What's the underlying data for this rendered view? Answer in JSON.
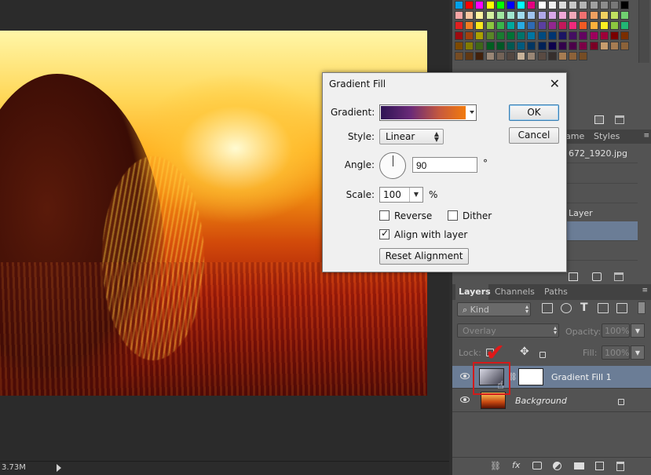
{
  "status": {
    "zoom_text": "3.73M"
  },
  "swatches": {
    "colors": [
      [
        "#00a0e9",
        "#ff0000",
        "#ff00ff",
        "#ffff00",
        "#00ff00",
        "#0000ff",
        "#00ffff",
        "#e4007f",
        "#ffffff",
        "#f0f0f0",
        "#dcdcdc",
        "#c8c8c8",
        "#b4b4b4",
        "#a0a0a0",
        "#8c8c8c",
        "#787878",
        "#000000"
      ],
      [
        "#f6a5a5",
        "#f8c6a0",
        "#fff3a0",
        "#d4f0a0",
        "#a0e7a0",
        "#a0e6cf",
        "#a0dcf0",
        "#a0c4f0",
        "#b0a8e8",
        "#d8a8e8",
        "#f0a8d8",
        "#f0a8b8",
        "#f07070",
        "#f0a060",
        "#f0d060",
        "#c0e060",
        "#70d070"
      ],
      [
        "#e02020",
        "#ef7d22",
        "#f8e71c",
        "#8cc63f",
        "#39b54a",
        "#00a99d",
        "#29abe2",
        "#2e6ab4",
        "#5b3fa0",
        "#92278f",
        "#c2185b",
        "#ee2a7b",
        "#f15a24",
        "#fbb03b",
        "#fcee21",
        "#8cc63f",
        "#22b573"
      ],
      [
        "#9e0b0f",
        "#a0410d",
        "#aba000",
        "#598527",
        "#197b30",
        "#007236",
        "#00746b",
        "#0076a3",
        "#004a80",
        "#003471",
        "#1b1464",
        "#440e62",
        "#630460",
        "#9e005d",
        "#9e0039",
        "#790000",
        "#7b2e00"
      ],
      [
        "#7d4900",
        "#827b00",
        "#406618",
        "#005e20",
        "#005826",
        "#005952",
        "#005b7f",
        "#003663",
        "#002157",
        "#0d004c",
        "#32004b",
        "#4b0049",
        "#7b0046",
        "#7a0026",
        "#c69c6d",
        "#a67c52",
        "#8c6239"
      ],
      [
        "#754c24",
        "#603813",
        "#42210b",
        "#998675",
        "#736357",
        "#534741",
        "#c7b299",
        "#998675",
        "#594a42",
        "#362f2d",
        "#a67c52",
        "#8c6239",
        "#754c24"
      ]
    ]
  },
  "history": {
    "tabs": [
      "ame",
      "Styles"
    ],
    "file_label": "672_1920.jpg",
    "layer_item": "Layer"
  },
  "layers_panel": {
    "tabs": [
      "Layers",
      "Channels",
      "Paths"
    ],
    "kind_label": "Kind",
    "blend_mode": "Overlay",
    "opacity_label": "Opacity:",
    "opacity_value": "100%",
    "lock_label": "Lock:",
    "fill_label": "Fill:",
    "fill_value": "100%",
    "layers": [
      {
        "name": "Gradient Fill 1",
        "selected": true
      },
      {
        "name": "Background",
        "selected": false
      }
    ],
    "bottom_icons": [
      "link-icon",
      "fx-icon",
      "mask-icon",
      "adjustment-icon",
      "group-icon",
      "new-layer-icon",
      "trash-icon"
    ]
  },
  "dialog": {
    "title": "Gradient Fill",
    "close": "✕",
    "gradient_label": "Gradient:",
    "gradient_colors": [
      "#2e1354",
      "#f27a0c"
    ],
    "style_label": "Style:",
    "style_value": "Linear",
    "angle_label": "Angle:",
    "angle_value": "90",
    "angle_unit": "°",
    "scale_label": "Scale:",
    "scale_value": "100",
    "scale_unit": "%",
    "reverse_label": "Reverse",
    "reverse_checked": false,
    "dither_label": "Dither",
    "dither_checked": false,
    "align_label": "Align with layer",
    "align_checked": true,
    "reset_label": "Reset Alignment",
    "ok_label": "OK",
    "cancel_label": "Cancel"
  },
  "annotation": {
    "check_glyph": "✔",
    "color": "#e01818"
  }
}
